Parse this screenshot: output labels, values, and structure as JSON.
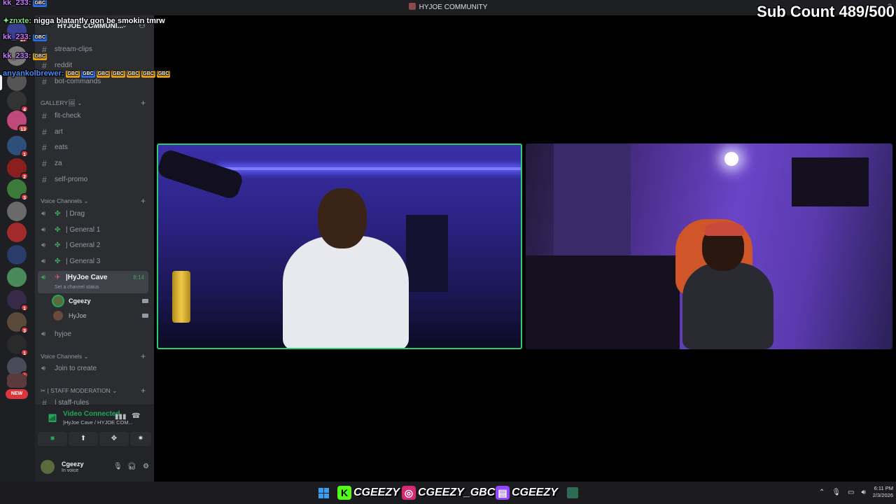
{
  "window": {
    "title": "HYJOE COMMUNITY"
  },
  "server": {
    "name": "HYJOE COMMUNI..."
  },
  "rail": {
    "badges": [
      "27",
      "4",
      "13",
      "1",
      "2",
      "3",
      "1",
      "3",
      "1",
      "1",
      "1"
    ],
    "new_label": "NEW"
  },
  "channels": {
    "top": [
      {
        "label": "stream-clips"
      },
      {
        "label": "reddit"
      },
      {
        "label": "bot-commands"
      }
    ],
    "gallery_category": "GALLERY🖼",
    "gallery": [
      {
        "label": "fit-check"
      },
      {
        "label": "art"
      },
      {
        "label": "eats"
      },
      {
        "label": "za"
      },
      {
        "label": "self-promo"
      }
    ],
    "voice_category": "Voice Channels",
    "voice": [
      {
        "label": "| Drag"
      },
      {
        "label": "| General 1"
      },
      {
        "label": "| General 2"
      },
      {
        "label": "| General 3"
      }
    ],
    "active_voice": {
      "label": "|HyJoe Cave",
      "status": "Set a channel status",
      "time": "8:14"
    },
    "voice_users": [
      {
        "name": "Cgeezy"
      },
      {
        "name": "HyJoe"
      }
    ],
    "text_after": {
      "label": "hyjoe"
    },
    "voice_category2": "Voice Channels",
    "join_to_create": "Join to create",
    "staff_category": "| STAFF MODERATION",
    "staff_partial": "| staff-rules"
  },
  "voice_panel": {
    "title": "Video Connected",
    "subtitle": "|HyJoe Cave / HYJOE COM..."
  },
  "user": {
    "name": "Cgeezy",
    "status": "In voice"
  },
  "chat": [
    {
      "user": "kk_233:",
      "text": "",
      "emotes": [
        "GBC"
      ]
    },
    {
      "user": "znxte:",
      "text": "nigga blatantly gon be smokin tmrw",
      "emotes": []
    },
    {
      "user": "kk_233:",
      "text": "",
      "emotes": [
        "GBC"
      ]
    },
    {
      "user": "kk_233:",
      "text": "",
      "emotes": [
        "GBC"
      ]
    },
    {
      "user": "anyankolbrewer:",
      "text": "",
      "emotes": [
        "GBC",
        "GBC",
        "GBC",
        "GBC",
        "GBC",
        "GBC",
        "GBC"
      ]
    }
  ],
  "overlay": {
    "sub_count": "Sub Count 489/500"
  },
  "taskbar": {
    "socials": [
      {
        "platform": "kick",
        "handle": "CGEEZY",
        "color": "#53fc18",
        "glyph": "K"
      },
      {
        "platform": "instagram",
        "handle": "CGEEZY_GBC",
        "color": "#d62976",
        "glyph": "◎"
      },
      {
        "platform": "twitch",
        "handle": "CGEEZY",
        "color": "#9146ff",
        "glyph": "▤"
      }
    ],
    "time": "6:11 PM",
    "date": "2/3/2026"
  },
  "colors": {
    "accent_green": "#23a55a",
    "bg_dark": "#1e1f22",
    "sidebar": "#2b2d31"
  }
}
